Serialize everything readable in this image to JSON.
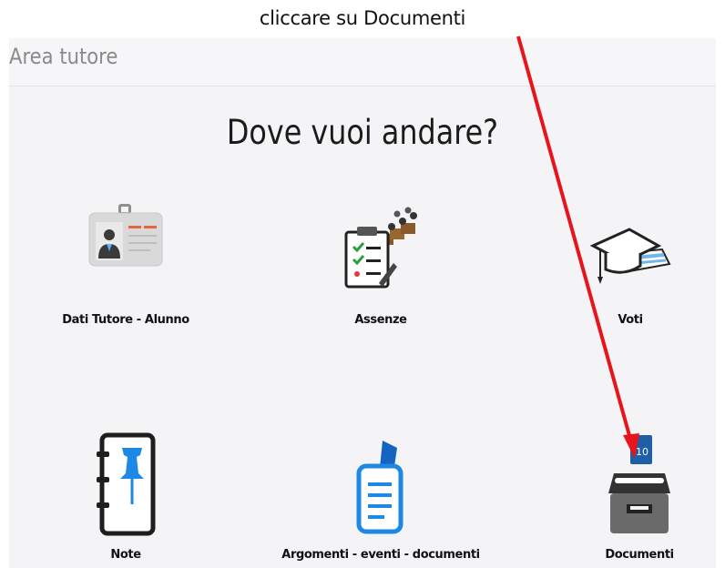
{
  "annotation": "cliccare su Documenti",
  "panel": {
    "title": "Area tutore",
    "question": "Dove vuoi andare?"
  },
  "tiles": [
    {
      "label": "Dati Tutore - Alunno",
      "icon": "id-card-icon"
    },
    {
      "label": "Assenze",
      "icon": "attendance-clipboard-icon"
    },
    {
      "label": "Voti",
      "icon": "graduation-cap-icon"
    },
    {
      "label": "Note",
      "icon": "notebook-pin-icon"
    },
    {
      "label": "Argomenti - eventi - documenti",
      "icon": "documents-bookmark-icon"
    },
    {
      "label": "Documenti",
      "icon": "document-tray-icon"
    }
  ],
  "colors": {
    "arrow": "#e8141b",
    "pin_blue": "#1e88e5",
    "panel_bg": "#f4f4f7"
  }
}
